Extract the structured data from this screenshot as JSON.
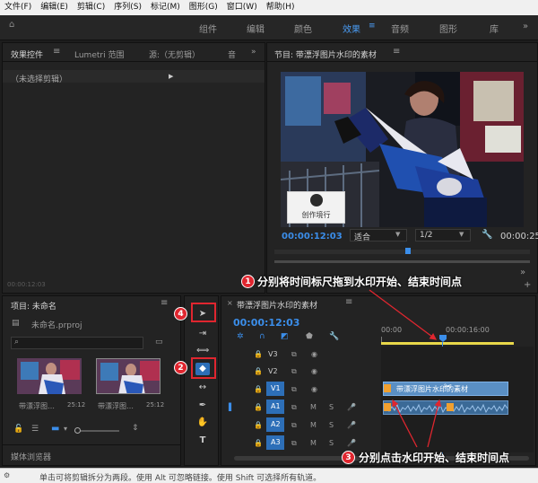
{
  "menu": [
    "文件(F)",
    "编辑(E)",
    "剪辑(C)",
    "序列(S)",
    "标记(M)",
    "图形(G)",
    "窗口(W)",
    "帮助(H)"
  ],
  "workspace_tabs": [
    {
      "label": "组件",
      "active": false
    },
    {
      "label": "编辑",
      "active": false
    },
    {
      "label": "颜色",
      "active": false
    },
    {
      "label": "效果",
      "active": true
    },
    {
      "label": "音频",
      "active": false
    },
    {
      "label": "图形",
      "active": false
    },
    {
      "label": "库",
      "active": false
    }
  ],
  "effect_controls": {
    "tab_effect": "效果控件",
    "tab_lumetri": "Lumetri 范围",
    "tab_source": "源:（无剪辑）",
    "tab_audio": "音",
    "no_clip": "（未选择剪辑）",
    "timecode": "00:00:12:03"
  },
  "program": {
    "title": "节目: 带漂浮图片水印的素材",
    "timecode": "00:00:12:03",
    "fit": "适合",
    "resolution": "1/2",
    "end_timecode": "00:00:25",
    "watermark_text": "创作境行"
  },
  "project": {
    "title": "项目: 未命名",
    "file": "未命名.prproj",
    "thumbs": [
      {
        "name": "带漂浮图…",
        "duration": "25:12"
      },
      {
        "name": "带漂浮图…",
        "duration": "25:12"
      }
    ],
    "media_browser": "媒体浏览器"
  },
  "timeline": {
    "title": "带漂浮图片水印的素材",
    "timecode": "00:00:12:03",
    "ruler": [
      "00:00",
      "00:00:16:00"
    ],
    "video_tracks": [
      "V3",
      "V2",
      "V1"
    ],
    "audio_tracks": [
      "A1",
      "A2",
      "A3"
    ],
    "clip_label": "带漂浮图片水印的素材",
    "clip_label_b": "带漂浮图片水印的素材"
  },
  "status_bar": "单击可将剪辑拆分为两段。使用 Alt 可忽略链接。使用 Shift 可选择所有轨道。",
  "annotations": {
    "n1": "1",
    "t1": "分别将时间标尺拖到水印开始、结束时间点",
    "n2": "2",
    "n3": "3",
    "t3": "分别点击水印开始、结束时间点",
    "n4": "4"
  },
  "colors": {
    "accent": "#3b8eea",
    "annotation": "#e0262f",
    "playhead": "#3b8eea"
  }
}
